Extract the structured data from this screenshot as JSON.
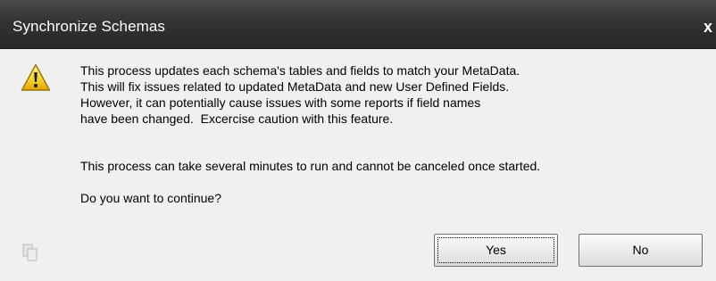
{
  "window": {
    "title": "Synchronize Schemas",
    "close_glyph": "x"
  },
  "message": {
    "paragraph1": "This process updates each schema's tables and fields to match your MetaData.\nThis will fix issues related to updated MetaData and new User Defined Fields.\nHowever, it can potentially cause issues with some reports if field names\nhave been changed.  Excercise caution with this feature.",
    "paragraph2": "This process can take several minutes to run and cannot be canceled once started.",
    "question": "Do you want to continue?"
  },
  "icons": {
    "main": "warning-icon",
    "footer": "copy-icon"
  },
  "buttons": {
    "yes_label": "Yes",
    "no_label": "No"
  },
  "colors": {
    "titlebar": "#333333",
    "dialog_background": "#f0f0f0",
    "warning_yellow": "#f5d21e"
  }
}
